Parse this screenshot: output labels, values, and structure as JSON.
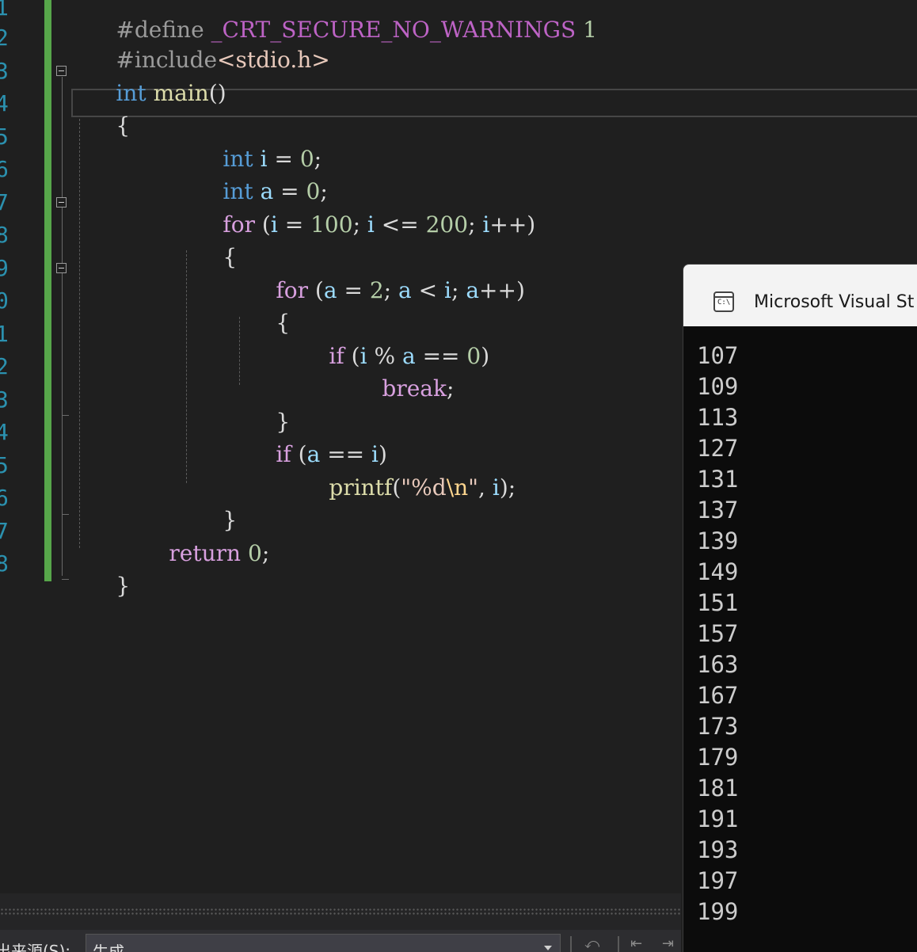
{
  "editor": {
    "line_numbers": [
      "1",
      "2",
      "3",
      "4",
      "5",
      "6",
      "7",
      "8",
      "9",
      "0",
      "1",
      "2",
      "3",
      "4",
      "5",
      "6",
      "7",
      "8"
    ],
    "code": {
      "l1": {
        "directive": "#define",
        "macro": "_CRT_SECURE_NO_WARNINGS",
        "value": "1"
      },
      "l2": {
        "directive": "#include",
        "header": "<stdio.h>"
      },
      "l3": {
        "type": "int",
        "name": "main",
        "parens": "()"
      },
      "l4": {
        "brace": "{"
      },
      "l5": {
        "type": "int",
        "var": "i",
        "op": "=",
        "num": "0",
        "end": ";"
      },
      "l6": {
        "type": "int",
        "var": "a",
        "op": "=",
        "num": "0",
        "end": ";"
      },
      "l7": {
        "kw": "for",
        "open": "(",
        "v1": "i",
        "eq": "=",
        "n1": "100",
        "s1": ";",
        "v2": "i",
        "le": "<=",
        "n2": "200",
        "s2": ";",
        "v3": "i",
        "inc": "++",
        "close": ")"
      },
      "l8": {
        "brace": "{"
      },
      "l9": {
        "kw": "for",
        "open": "(",
        "v1": "a",
        "eq": "=",
        "n1": "2",
        "s1": ";",
        "v2": "a",
        "lt": "<",
        "v3": "i",
        "s2": ";",
        "v4": "a",
        "inc": "++",
        "close": ")"
      },
      "l10": {
        "brace": "{"
      },
      "l11": {
        "kw": "if",
        "open": "(",
        "v1": "i",
        "mod": "%",
        "v2": "a",
        "eqeq": "==",
        "num": "0",
        "close": ")"
      },
      "l12": {
        "kw": "break",
        "end": ";"
      },
      "l13": {
        "brace": "}"
      },
      "l14": {
        "kw": "if",
        "open": "(",
        "v1": "a",
        "eqeq": "==",
        "v2": "i",
        "close": ")"
      },
      "l15": {
        "fn": "printf",
        "open": "(",
        "quote_open": "\"",
        "fmt": "%d",
        "esc": "\\n",
        "quote_close": "\"",
        "comma": ",",
        "var": "i",
        "close": ")",
        "end": ";"
      },
      "l16": {
        "brace": "}"
      },
      "l17": {
        "kw": "return",
        "num": "0",
        "end": ";"
      },
      "l18": {
        "brace": "}"
      }
    },
    "colors": {
      "keyword": "#569cd6",
      "control": "#d8a0df",
      "number": "#b5cea8",
      "function": "#dcdcaa",
      "variable": "#9cdcfe",
      "string": "#e8c9bb",
      "line_number": "#2b91af",
      "change_bar": "#57a64a"
    }
  },
  "console": {
    "title": "Microsoft Visual St",
    "icon": "console-app-icon",
    "icon_text": "C:\\",
    "output": [
      "107",
      "109",
      "113",
      "127",
      "131",
      "137",
      "139",
      "149",
      "151",
      "157",
      "163",
      "167",
      "173",
      "179",
      "181",
      "191",
      "193",
      "197",
      "199"
    ]
  },
  "output_pane": {
    "source_label": "出来源(S):",
    "source_value": "生成"
  }
}
